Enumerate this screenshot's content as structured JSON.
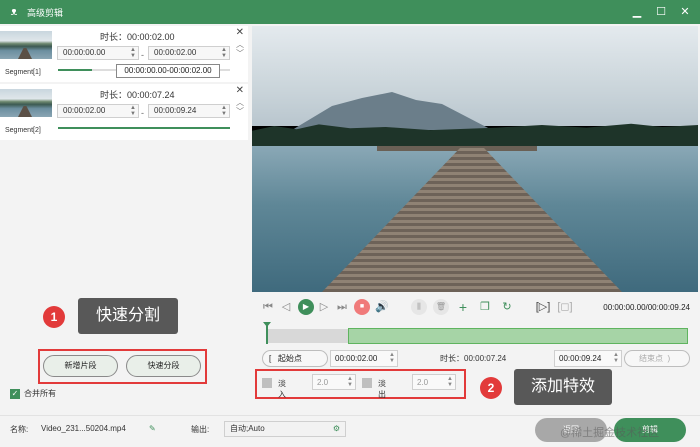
{
  "window": {
    "title": "高级剪辑",
    "icon": "rabbit-logo-icon"
  },
  "segments": [
    {
      "name": "Segment[1]",
      "duration_label": "时长：00:00:02.00",
      "start": "00:00:00.00",
      "end": "00:00:02.00",
      "progress": 0.2
    },
    {
      "name": "Segment[2]",
      "duration_label": "时长：00:00:07.24",
      "start": "00:00:02.00",
      "end": "00:00:09.24",
      "progress": 1.0
    }
  ],
  "tooltip": "00:00:00.00-00:00:02.00",
  "buttons": {
    "new_segment": "新增片段",
    "quick_split": "快速分段"
  },
  "merge_all": {
    "label": "合并所有",
    "checked": true
  },
  "callouts": {
    "one_num": "1",
    "one_text": "快速分割",
    "two_num": "2",
    "two_text": "添加特效"
  },
  "player": {
    "timecode": "00:00:00.00/00:00:09.24",
    "icons": [
      "prev-icon",
      "back-icon",
      "play-icon",
      "forward-icon",
      "next-icon",
      "stop-icon",
      "volume-icon",
      "split-icon",
      "delete-icon",
      "add-icon",
      "copy-icon",
      "reset-icon",
      "cut-mode-icon",
      "fit-icon"
    ]
  },
  "timeline": {
    "selection_start_fraction": 0.2,
    "selection_end_fraction": 1.0
  },
  "cut": {
    "start_label": "起始点",
    "start_value": "00:00:02.00",
    "duration_label": "时长：00:00:07.24",
    "end_value": "00:00:09.24",
    "end_label": "结束点"
  },
  "effects": {
    "fade_in_label": "淡入",
    "fade_in_value": "2.0",
    "fade_out_label": "淡出",
    "fade_out_value": "2.0"
  },
  "footer": {
    "name_label": "名称:",
    "name_value": "Video_231...50204.mp4",
    "output_label": "输出:",
    "output_value": "自动;Auto",
    "back": "返回",
    "cut": "剪辑"
  },
  "watermark": "@稀土掘金技术社区",
  "colors": {
    "primary": "#3f8f5b",
    "highlight": "#e23a3a"
  }
}
